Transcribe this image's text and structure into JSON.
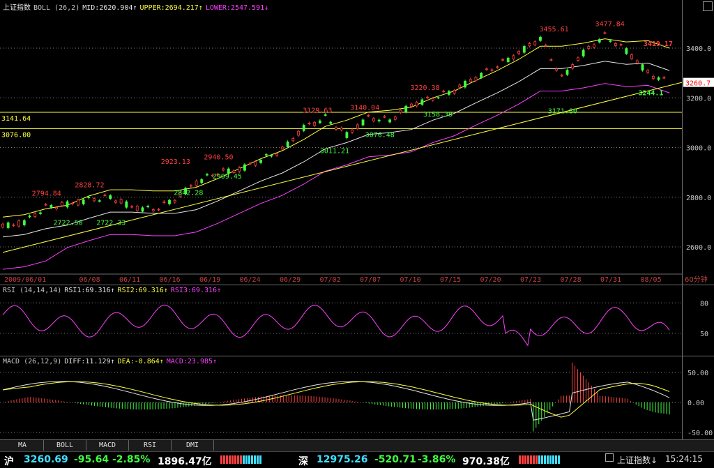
{
  "main": {
    "header": {
      "name": "上证指数",
      "indicator": "BOLL (26,2)",
      "mid": "MID:2620.904↑",
      "upper": "UPPER:2694.217↑",
      "lower": "LOWER:2547.591↓"
    },
    "y_ticks": [
      "3400.0",
      "3200.0",
      "3000.0",
      "2800.0",
      "2600.0"
    ],
    "price_tag": "3260.7",
    "x_ticks": [
      "2009/06/01",
      "06/08",
      "06/11",
      "06/16",
      "06/19",
      "06/24",
      "06/29",
      "07/02",
      "07/07",
      "07/10",
      "07/15",
      "07/20",
      "07/23",
      "07/28",
      "07/31",
      "08/05"
    ],
    "period": "60分钟",
    "hlines": [
      {
        "label": "3141.64",
        "value": 3141.64
      },
      {
        "label": "3076.00",
        "value": 3076.0
      }
    ],
    "annotations": [
      {
        "text": "2794.84",
        "color": "#ff4040",
        "x": 2,
        "y": 2794.84,
        "pos": "above"
      },
      {
        "text": "2828.72",
        "color": "#ff4040",
        "x": 4,
        "y": 2828.72,
        "pos": "above"
      },
      {
        "text": "2722.50",
        "color": "#40ff40",
        "x": 3,
        "y": 2722.5,
        "pos": "below"
      },
      {
        "text": "2722.33",
        "color": "#40ff40",
        "x": 5,
        "y": 2722.33,
        "pos": "below"
      },
      {
        "text": "2923.13",
        "color": "#ff4040",
        "x": 8,
        "y": 2923.13,
        "pos": "above"
      },
      {
        "text": "2842.28",
        "color": "#40ff40",
        "x": 8.6,
        "y": 2842.28,
        "pos": "below"
      },
      {
        "text": "2940.50",
        "color": "#ff4040",
        "x": 10,
        "y": 2940.5,
        "pos": "above"
      },
      {
        "text": "2909.45",
        "color": "#40ff40",
        "x": 10.4,
        "y": 2909.45,
        "pos": "below"
      },
      {
        "text": "3129.63",
        "color": "#ff4040",
        "x": 14.6,
        "y": 3129.63,
        "pos": "above"
      },
      {
        "text": "3140.04",
        "color": "#ff4040",
        "x": 16.8,
        "y": 3140.04,
        "pos": "above"
      },
      {
        "text": "3011.21",
        "color": "#40ff40",
        "x": 15.4,
        "y": 3011.21,
        "pos": "below"
      },
      {
        "text": "3076.48",
        "color": "#40ff40",
        "x": 17.5,
        "y": 3076.48,
        "pos": "below"
      },
      {
        "text": "3220.38",
        "color": "#ff4040",
        "x": 19.6,
        "y": 3220.38,
        "pos": "above"
      },
      {
        "text": "3158.38",
        "color": "#40ff40",
        "x": 20.2,
        "y": 3158.38,
        "pos": "below"
      },
      {
        "text": "3455.61",
        "color": "#ff4040",
        "x": 25.6,
        "y": 3455.61,
        "pos": "above"
      },
      {
        "text": "3171.80",
        "color": "#40ff40",
        "x": 26.0,
        "y": 3171.8,
        "pos": "below"
      },
      {
        "text": "3477.84",
        "color": "#ff4040",
        "x": 28.2,
        "y": 3477.84,
        "pos": "above"
      },
      {
        "text": "3419.17",
        "color": "#ff4040",
        "x": 29.6,
        "y": 3419.17,
        "pos": "side"
      },
      {
        "text": "3244.1",
        "color": "#40ff40",
        "x": 30.2,
        "y": 3244.1,
        "pos": "below"
      }
    ]
  },
  "rsi": {
    "header": {
      "indicator": "RSI (14,14,14)",
      "rsi1": "RSI1:69.316↑",
      "rsi2": "RSI2:69.316↑",
      "rsi3": "RSI3:69.316↑"
    },
    "y_ticks": [
      "80",
      "50"
    ]
  },
  "macd": {
    "header": {
      "indicator": "MACD (26,12,9)",
      "diff": "DIFF:11.129↑",
      "dea": "DEA:-0.864↑",
      "macd": "MACD:23.985↑"
    },
    "y_ticks": [
      "50.00",
      "0.00",
      "-50.00"
    ]
  },
  "tabs": [
    "MA",
    "BOLL",
    "MACD",
    "RSI",
    "DMI"
  ],
  "status": {
    "sh_label": "沪",
    "sh_price": "3260.69",
    "sh_change": "-95.64",
    "sh_pct": "-2.85%",
    "sh_amount": "1896.47亿",
    "sz_label": "深",
    "sz_price": "12975.26",
    "sz_change": "-520.71",
    "sz_pct": "-3.86%",
    "sz_amount": "970.38亿",
    "index_name": "上证指数↓",
    "time": "15:24:15"
  },
  "colors": {
    "up": "#ff4040",
    "down": "#40ff40",
    "yellow": "#ffff40",
    "magenta": "#ff40ff",
    "white": "#e6e6e6",
    "cyan": "#40e0ff"
  }
}
